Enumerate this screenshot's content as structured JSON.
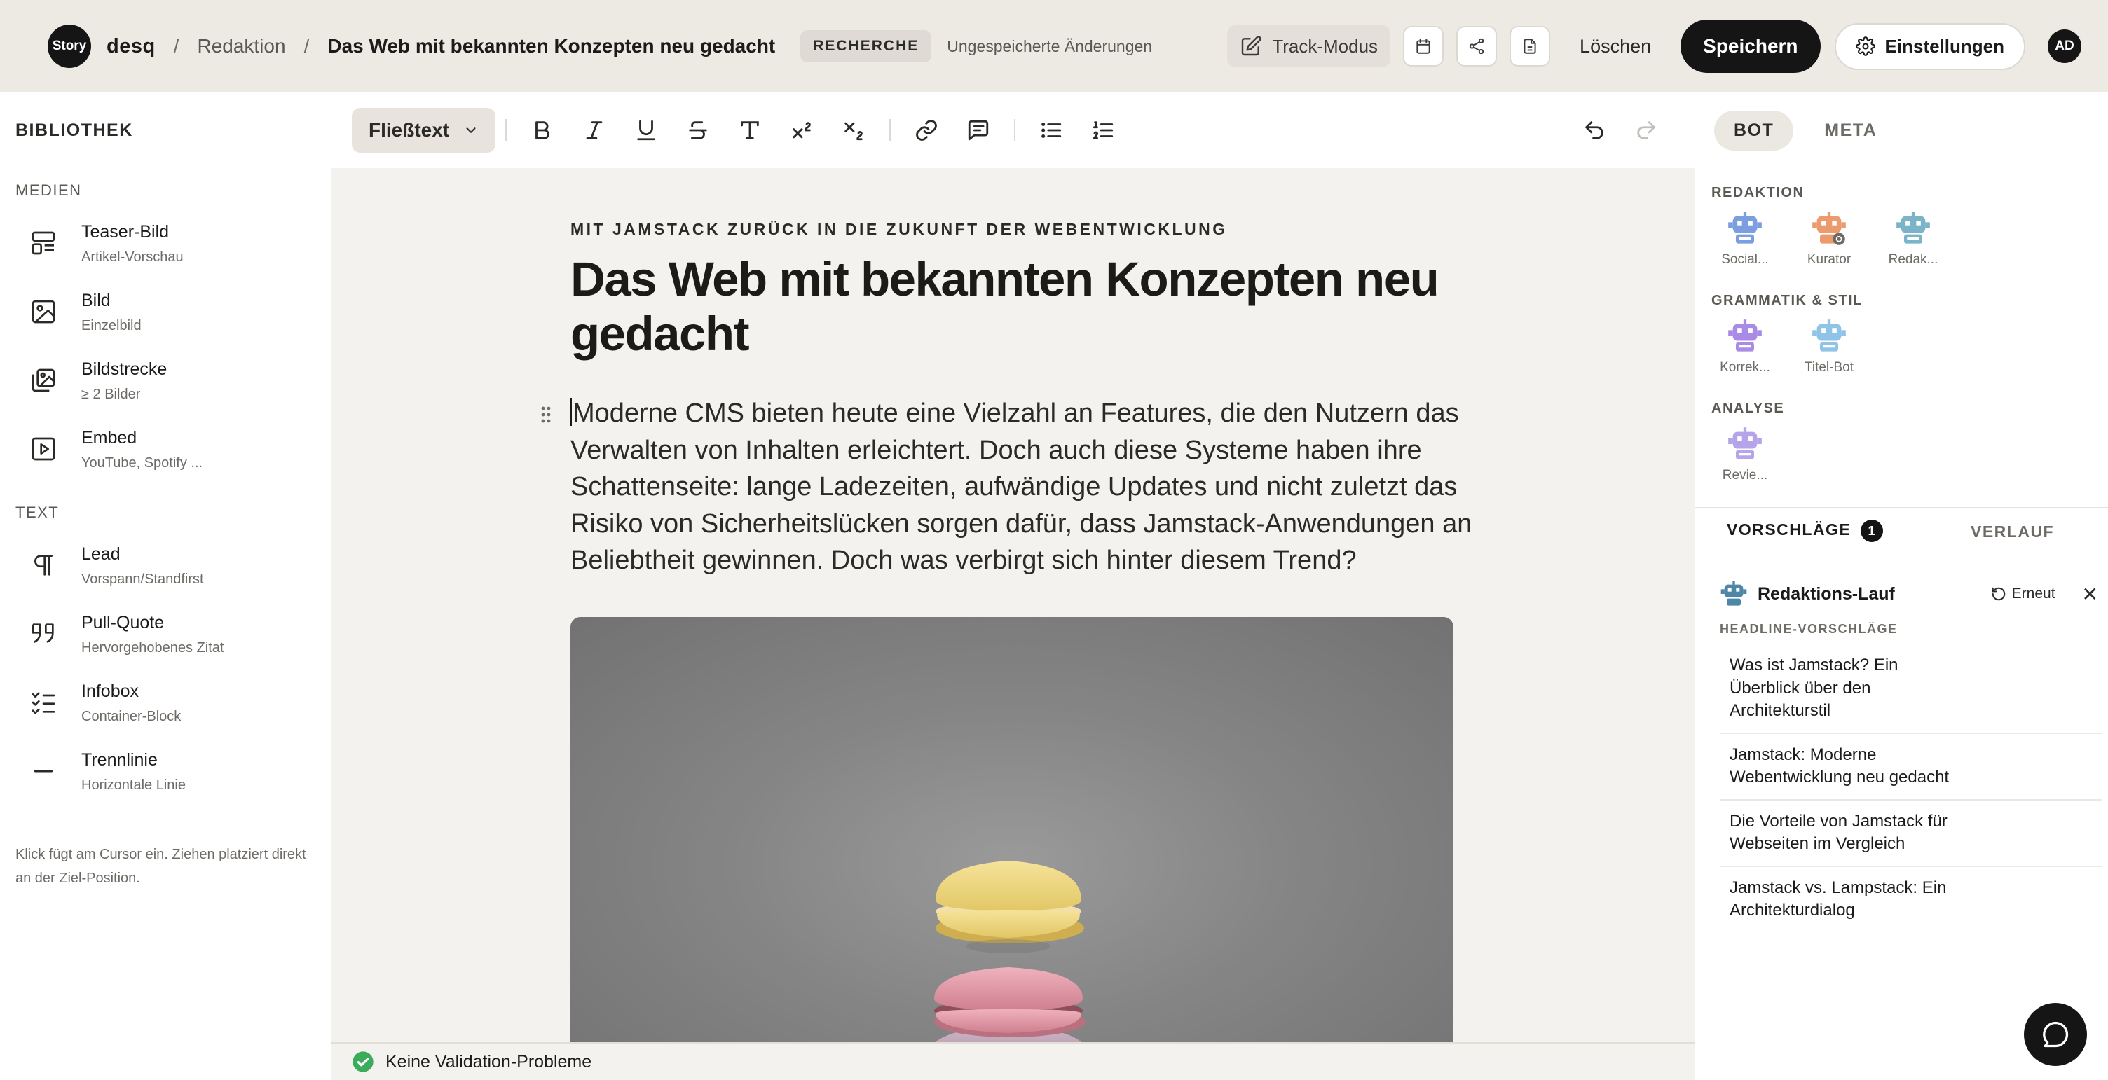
{
  "header": {
    "logo_text": "Story",
    "brand": "desq",
    "breadcrumb_section": "Redaktion",
    "breadcrumb_current": "Das Web mit bekannten Konzepten neu gedacht",
    "status_badge": "RECHERCHE",
    "unsaved_text": "Ungespeicherte Änderungen",
    "track_mode_label": "Track-Modus",
    "delete_label": "Löschen",
    "save_label": "Speichern",
    "settings_label": "Einstellungen",
    "avatar_initials": "AD",
    "icons": [
      "pencil-square-icon",
      "calendar-icon",
      "share-icon",
      "document-icon",
      "gear-icon"
    ]
  },
  "sidebar": {
    "title": "BIBLIOTHEK",
    "sections": [
      {
        "title": "MEDIEN",
        "items": [
          {
            "label": "Teaser-Bild",
            "sub": "Artikel-Vorschau",
            "icon": "layout-icon"
          },
          {
            "label": "Bild",
            "sub": "Einzelbild",
            "icon": "image-icon"
          },
          {
            "label": "Bildstrecke",
            "sub": "≥ 2 Bilder",
            "icon": "gallery-icon"
          },
          {
            "label": "Embed",
            "sub": "YouTube, Spotify ...",
            "icon": "play-icon"
          }
        ]
      },
      {
        "title": "TEXT",
        "items": [
          {
            "label": "Lead",
            "sub": "Vorspann/Standfirst",
            "icon": "pilcrow-icon"
          },
          {
            "label": "Pull-Quote",
            "sub": "Hervorgehobenes Zitat",
            "icon": "quote-icon"
          },
          {
            "label": "Infobox",
            "sub": "Container-Block",
            "icon": "checklist-icon"
          },
          {
            "label": "Trennlinie",
            "sub": "Horizontale Linie",
            "icon": "minus-icon"
          }
        ]
      }
    ],
    "help_text": "Klick fügt am Cursor ein. Ziehen platziert direkt an der Ziel-Position."
  },
  "toolbar": {
    "style_select": "Fließtext",
    "buttons": [
      "bold-icon",
      "italic-icon",
      "underline-icon",
      "strikethrough-icon",
      "text-type-icon",
      "superscript-icon",
      "subscript-icon",
      "link-icon",
      "comment-icon",
      "bullet-list-icon",
      "numbered-list-icon",
      "undo-icon",
      "redo-icon"
    ]
  },
  "editor": {
    "kicker": "MIT JAMSTACK ZURÜCK IN DIE ZUKUNFT DER WEBENTWICKLUNG",
    "headline": "Das Web mit bekannten Konzepten neu gedacht",
    "body": "Moderne CMS bieten heute eine Vielzahl an Features, die den Nutzern das Verwalten von Inhalten erleichtert. Doch auch diese Systeme haben ihre Schattenseite: lange Ladezeiten, aufwändige Updates und nicht zuletzt das Risiko von Sicherheitslücken sorgen dafür, dass Jamstack-Anwendungen an Beliebtheit gewinnen. Doch was verbirgt sich hinter diesem Trend?",
    "image_subject": "stack of macarons"
  },
  "validation": {
    "text": "Keine Validation-Probleme"
  },
  "right_panel": {
    "tabs": [
      "BOT",
      "META"
    ],
    "active_tab": "BOT",
    "bot_groups": [
      {
        "title": "REDAKTION",
        "bots": [
          {
            "label": "Social...",
            "color": "#7b9ee0"
          },
          {
            "label": "Kurator",
            "color": "#ec9b6e"
          },
          {
            "label": "Redak...",
            "color": "#7bb3c8"
          }
        ]
      },
      {
        "title": "GRAMMATIK & STIL",
        "bots": [
          {
            "label": "Korrek...",
            "color": "#a98be6"
          },
          {
            "label": "Titel-Bot",
            "color": "#8fc3e8"
          }
        ]
      },
      {
        "title": "ANALYSE",
        "bots": [
          {
            "label": "Revie...",
            "color": "#b5a4ea"
          }
        ]
      }
    ],
    "suggestions_tab": "VORSCHLÄGE",
    "suggestions_count": "1",
    "history_tab": "VERLAUF",
    "run": {
      "title": "Redaktions-Lauf",
      "retry_label": "Erneut",
      "section_label": "HEADLINE-VORSCHLÄGE",
      "headlines": [
        "Was ist Jamstack? Ein Überblick über den Architekturstil",
        "Jamstack: Moderne Webentwicklung neu gedacht",
        "Die Vorteile von Jamstack für Webseiten im Vergleich",
        "Jamstack vs. Lampstack: Ein Architekturdialog"
      ]
    }
  },
  "colors": {
    "header_bg": "#ede9e3",
    "editor_bg": "#f4f2ee",
    "primary_dark": "#151515",
    "valid_green": "#3bab5c"
  }
}
